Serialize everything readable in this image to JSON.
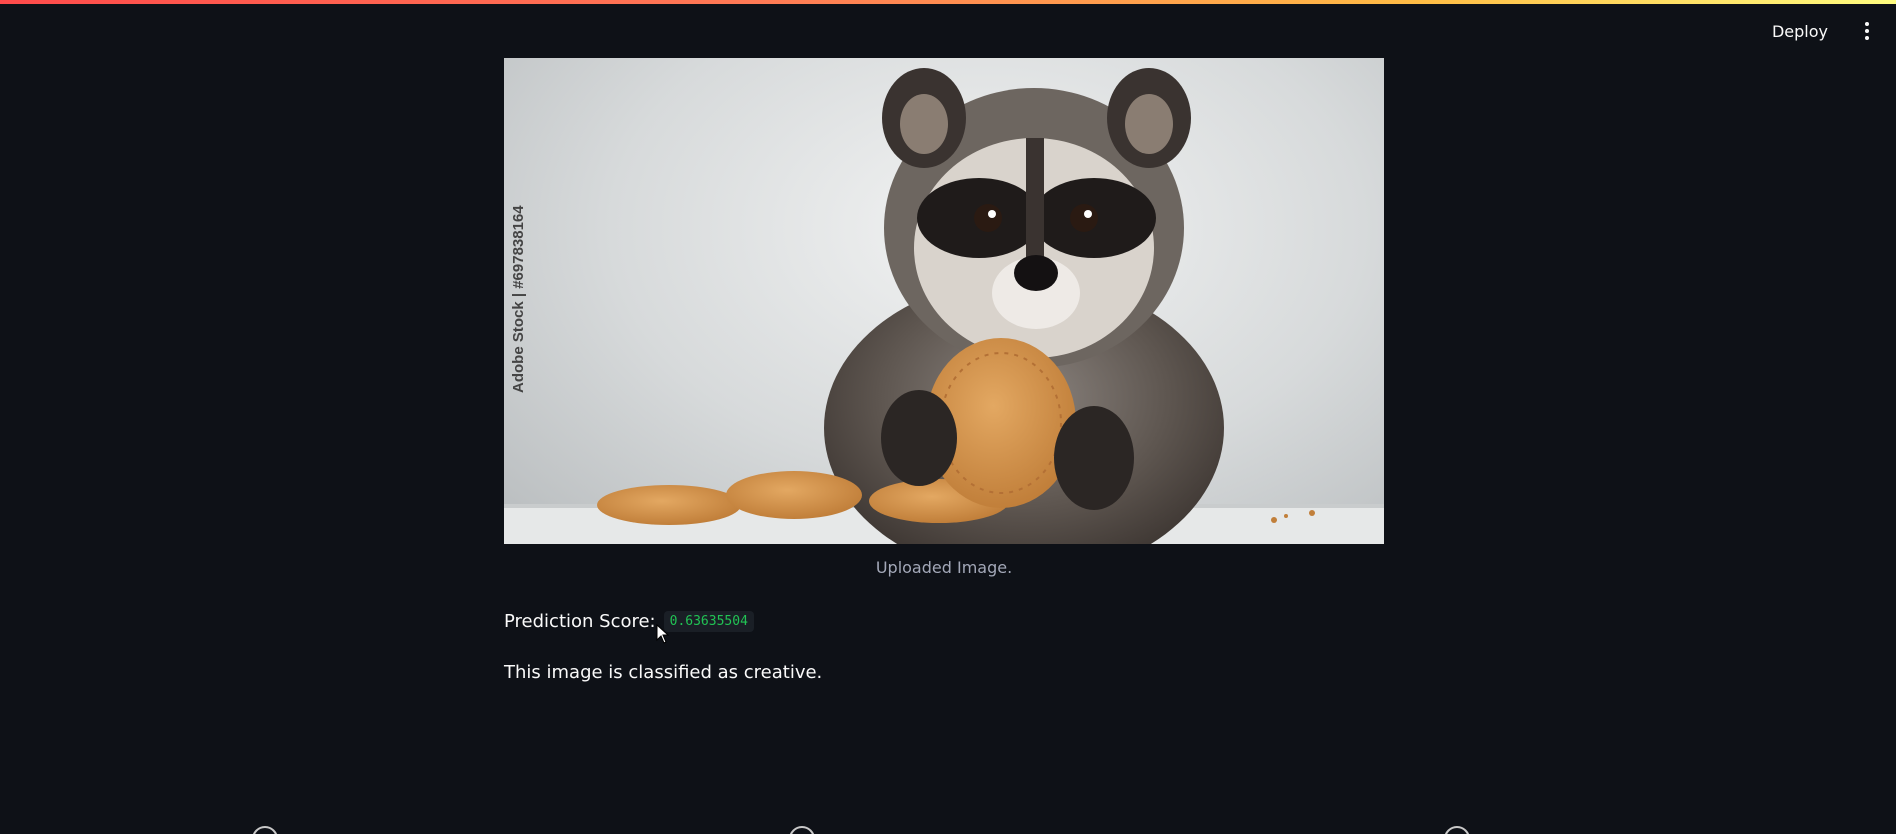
{
  "header": {
    "deploy_label": "Deploy",
    "menu_icon": "more-vertical-icon"
  },
  "main": {
    "image": {
      "watermark": "Adobe Stock | #697838164",
      "caption": "Uploaded Image."
    },
    "prediction": {
      "label": "Prediction Score:",
      "value": "0.63635504"
    },
    "classification_text": "This image is classified as creative."
  },
  "colors": {
    "background": "#0e1117",
    "text": "#fafafa",
    "caption": "#a3a8b8",
    "score_value": "#21c354",
    "score_background": "#1a1f26"
  }
}
